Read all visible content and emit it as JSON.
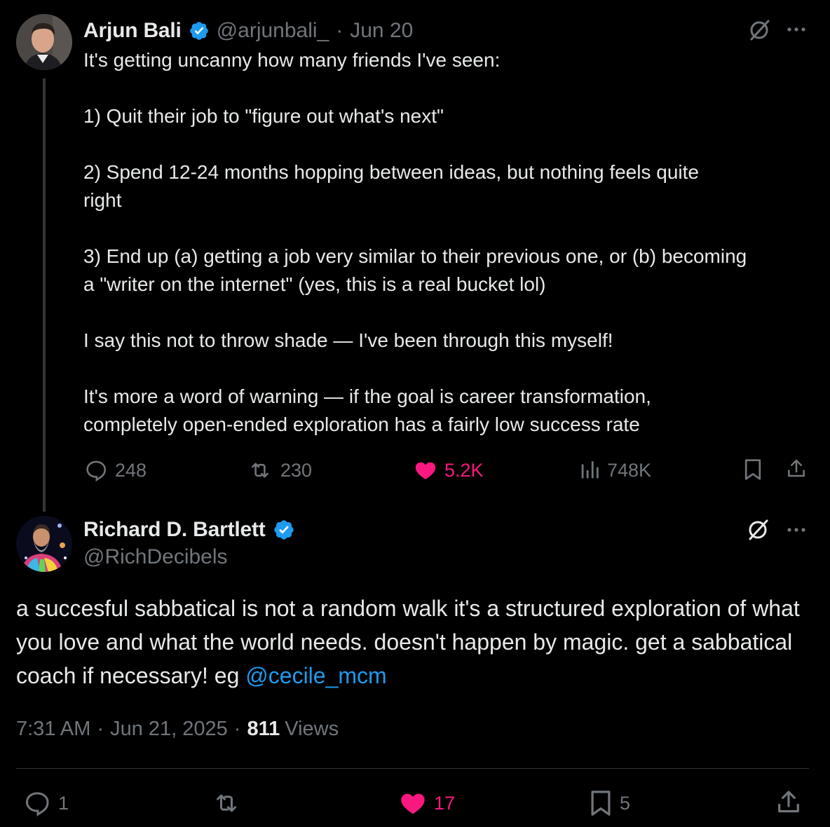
{
  "parent_tweet": {
    "author_name": "Arjun Bali",
    "author_handle": "@arjunbali_",
    "separator": "·",
    "date": "Jun 20",
    "body": "It's getting uncanny how many friends I've seen:\n\n1) Quit their job to \"figure out what's next\"\n\n2) Spend 12-24 months hopping between ideas, but nothing feels quite\nright\n\n3) End up (a) getting a job very similar to their previous one, or (b) becoming\na \"writer on the internet\" (yes, this is a real bucket lol)\n\nI say this not to throw shade — I've been through this myself!\n\nIt's more a word of warning — if the goal is career transformation,\ncompletely open-ended exploration has a fairly low success rate",
    "replies": "248",
    "reposts": "230",
    "likes": "5.2K",
    "views": "748K"
  },
  "reply_tweet": {
    "author_name": "Richard D. Bartlett",
    "author_handle": "@RichDecibels",
    "body_text": "a succesful sabbatical is not a random walk it's a structured exploration of what you love and what the world needs. doesn't happen by magic. get a sabbatical coach if necessary! eg ",
    "mention": "@cecile_mcm",
    "time": "7:31 AM",
    "date": "Jun 21, 2025",
    "separator": "·",
    "views_count": "811",
    "views_label": "Views",
    "replies": "1",
    "likes": "17",
    "bookmarks": "5"
  },
  "icons": {
    "verified": "verified-badge-icon",
    "grok": "grok-icon",
    "more": "more-dots-icon",
    "reply": "reply-icon",
    "repost": "repost-icon",
    "like": "heart-icon",
    "views": "views-chart-icon",
    "bookmark": "bookmark-icon",
    "share": "share-icon"
  },
  "colors": {
    "background": "#000000",
    "text": "#e7e9ea",
    "muted": "#71767b",
    "accent": "#1d9bf0",
    "like": "#f91880"
  }
}
